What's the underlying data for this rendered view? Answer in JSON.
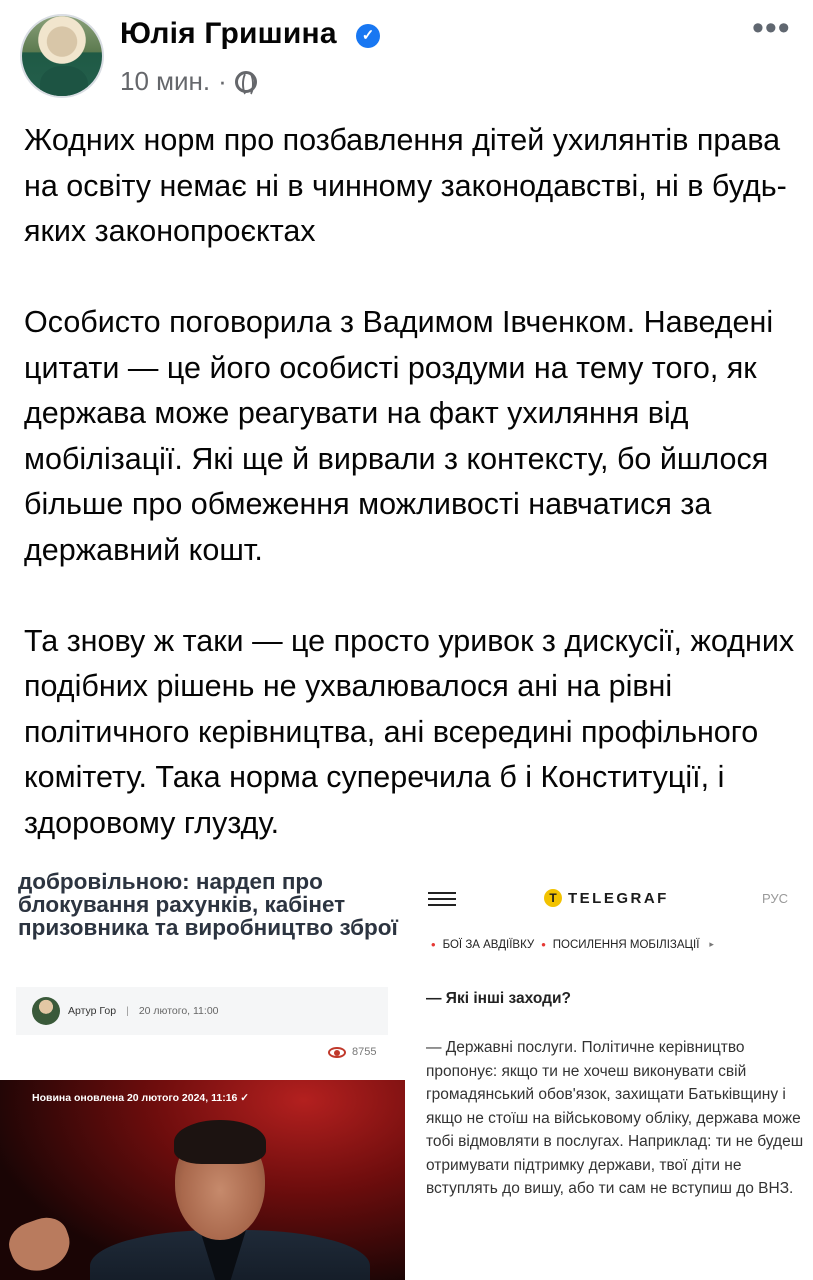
{
  "post": {
    "author": "Юлія Гришина",
    "verified_mark": "✓",
    "time": "10 мин.",
    "meta_separator": "·",
    "more_label": "•••",
    "paragraphs": [
      "Жодних норм про позбавлення дітей ухилянтів права на освіту немає ні в чинному законодавстві, ні в будь-яких законопроєктах",
      "Особисто поговорила з Вадимом Івченком. Наведені цитати — це його особисті роздуми на тему того, як держава може реагувати на факт ухиляння від мобілізації. Які ще й вирвали з контексту, бо йшлося більше про обмеження можливості навчатися за державний кошт.",
      "Та знову ж таки — це просто уривок з дискусії, жодних подібних рішень не ухвалювалося ані на рівні політичного керівництва, ані всередині профільного комітету. Така норма суперечила б і Конституції, і здоровому глузду."
    ]
  },
  "left_screenshot": {
    "headline": "добровільною: нардеп про блокування рахунків, кабінет призовника та виробництво зброї",
    "article_author": "Артур Гор",
    "separator": "|",
    "article_date": "20 лютого, 11:00",
    "views": "8755",
    "video_updated": "Новина оновлена 20 лютого 2024, 11:16 ✓"
  },
  "right_screenshot": {
    "logo_mark": "T",
    "logo": "TELEGRAF",
    "lang": "РУС",
    "topic_1": "БОЇ ЗА АВДІЇВКУ",
    "topic_2": "ПОСИЛЕННЯ МОБІЛІЗАЦІЇ",
    "topic_chevron": "▸",
    "question": "— Які інші заходи?",
    "answer": "— Державні послуги. Політичне керівництво пропонує: якщо ти не хочеш виконувати свій громадянський обов'язок, захищати Батьківщину і якщо не стоїш на військовому обліку, держава може тобі відмовляти в послугах. Наприклад: ти не будеш отримувати підтримку держави, твої діти не вступлять до вишу, або ти сам не вступиш до ВНЗ."
  },
  "colors": {
    "verified": "#1877f2",
    "secondary_text": "#65676b",
    "logo_yellow": "#f2c200",
    "topic_bullet": "#e53935"
  }
}
